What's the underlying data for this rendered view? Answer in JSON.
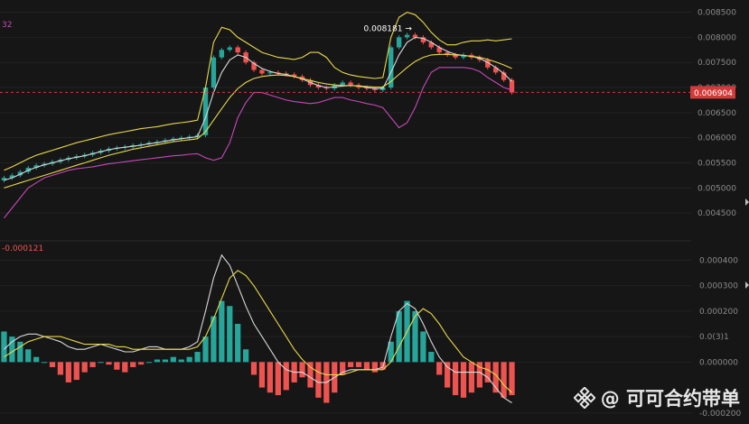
{
  "chart_data": [
    {
      "type": "line",
      "panel": "price",
      "indicator_label": "32",
      "y_ticks": [
        "0.008500",
        "0.008000",
        "0.007500",
        "0.007000",
        "0.006500",
        "0.006000",
        "0.005500",
        "0.005000",
        "0.004500"
      ],
      "ylim": [
        0.00425,
        0.0086
      ],
      "current_price_label": "0.006904",
      "current_price": 0.006904,
      "high_annotation": "0.008181",
      "high_value": 0.008181,
      "colors": {
        "up": "#26a69a",
        "down": "#ef5350",
        "ma_white": "#d8d8d8",
        "ma_yellow": "#e8d84a",
        "boll_magenta": "#c848b8",
        "price_tag": "#d33a3a"
      },
      "series": [
        {
          "role": "close",
          "values": [
            0.0052,
            0.00525,
            0.00532,
            0.0054,
            0.00545,
            0.00548,
            0.00552,
            0.00556,
            0.0056,
            0.00563,
            0.00566,
            0.0057,
            0.00574,
            0.00578,
            0.0058,
            0.00582,
            0.00585,
            0.00587,
            0.0059,
            0.00592,
            0.00595,
            0.00598,
            0.006,
            0.00602,
            0.00605,
            0.007,
            0.0076,
            0.00775,
            0.0078,
            0.0077,
            0.0075,
            0.00735,
            0.00728,
            0.0073,
            0.00728,
            0.00726,
            0.00722,
            0.00715,
            0.00705,
            0.007,
            0.00698,
            0.00705,
            0.0071,
            0.00705,
            0.007,
            0.00698,
            0.00695,
            0.007,
            0.0078,
            0.008,
            0.00805,
            0.008,
            0.0079,
            0.0078,
            0.0077,
            0.00765,
            0.0076,
            0.00765,
            0.0076,
            0.00755,
            0.0074,
            0.0073,
            0.00715,
            0.0069
          ]
        },
        {
          "role": "ma_short",
          "values": [
            0.00515,
            0.0052,
            0.00527,
            0.00535,
            0.00541,
            0.00546,
            0.0055,
            0.00554,
            0.00558,
            0.00561,
            0.00564,
            0.00568,
            0.00572,
            0.00576,
            0.00579,
            0.00581,
            0.00583,
            0.00585,
            0.00588,
            0.0059,
            0.00593,
            0.00596,
            0.00598,
            0.006,
            0.00602,
            0.0064,
            0.0069,
            0.0073,
            0.00755,
            0.00765,
            0.0076,
            0.00748,
            0.00738,
            0.00732,
            0.00728,
            0.00726,
            0.00722,
            0.00717,
            0.0071,
            0.00704,
            0.007,
            0.00701,
            0.00703,
            0.00704,
            0.00703,
            0.007,
            0.00698,
            0.00698,
            0.0073,
            0.00765,
            0.0079,
            0.008,
            0.00798,
            0.0079,
            0.0078,
            0.00772,
            0.00766,
            0.00764,
            0.00762,
            0.00758,
            0.0075,
            0.0074,
            0.00728,
            0.00712
          ]
        },
        {
          "role": "ma_long",
          "values": [
            0.005,
            0.00505,
            0.0051,
            0.00515,
            0.0052,
            0.00525,
            0.0053,
            0.00535,
            0.0054,
            0.00545,
            0.0055,
            0.00555,
            0.0056,
            0.00565,
            0.00569,
            0.00573,
            0.00577,
            0.0058,
            0.00583,
            0.00586,
            0.00589,
            0.00592,
            0.00594,
            0.00596,
            0.00598,
            0.00612,
            0.00635,
            0.00658,
            0.0068,
            0.00698,
            0.0071,
            0.00718,
            0.00722,
            0.00724,
            0.00725,
            0.00724,
            0.00722,
            0.00718,
            0.00714,
            0.0071,
            0.00707,
            0.00705,
            0.00704,
            0.00704,
            0.00703,
            0.00702,
            0.00701,
            0.00701,
            0.00712,
            0.00726,
            0.0074,
            0.00752,
            0.0076,
            0.00765,
            0.00766,
            0.00766,
            0.00765,
            0.00764,
            0.00762,
            0.0076,
            0.00756,
            0.00751,
            0.00745,
            0.00738
          ]
        },
        {
          "role": "boll_upper",
          "values": [
            0.00535,
            0.00542,
            0.0055,
            0.00558,
            0.00565,
            0.0057,
            0.00575,
            0.0058,
            0.00585,
            0.0059,
            0.00594,
            0.00598,
            0.00602,
            0.00606,
            0.00609,
            0.00612,
            0.00615,
            0.00618,
            0.0062,
            0.00622,
            0.00625,
            0.00628,
            0.0063,
            0.00632,
            0.00635,
            0.007,
            0.0079,
            0.0082,
            0.00815,
            0.008,
            0.0079,
            0.0078,
            0.0077,
            0.00765,
            0.0076,
            0.00758,
            0.00756,
            0.0076,
            0.0077,
            0.0077,
            0.0076,
            0.0074,
            0.0073,
            0.00725,
            0.00722,
            0.0072,
            0.00718,
            0.0072,
            0.008,
            0.0084,
            0.0085,
            0.00845,
            0.0083,
            0.0081,
            0.00795,
            0.00785,
            0.00785,
            0.0079,
            0.00793,
            0.00793,
            0.00795,
            0.00793,
            0.00795,
            0.00797
          ]
        },
        {
          "role": "boll_lower",
          "values": [
            0.0044,
            0.0046,
            0.0048,
            0.005,
            0.0051,
            0.0052,
            0.00525,
            0.0053,
            0.00535,
            0.00538,
            0.0054,
            0.00542,
            0.00545,
            0.00548,
            0.0055,
            0.00552,
            0.00554,
            0.00556,
            0.00558,
            0.0056,
            0.00562,
            0.00564,
            0.00565,
            0.00567,
            0.00568,
            0.0056,
            0.00555,
            0.0056,
            0.0059,
            0.0064,
            0.0067,
            0.0069,
            0.0069,
            0.00685,
            0.0068,
            0.00675,
            0.00672,
            0.0067,
            0.00668,
            0.0067,
            0.00675,
            0.0068,
            0.0068,
            0.00675,
            0.00672,
            0.00668,
            0.00665,
            0.0066,
            0.0064,
            0.0062,
            0.0063,
            0.0066,
            0.007,
            0.0073,
            0.0074,
            0.0074,
            0.0074,
            0.0074,
            0.00738,
            0.00732,
            0.0072,
            0.0071,
            0.007,
            0.00695
          ]
        }
      ]
    },
    {
      "type": "bar",
      "panel": "macd",
      "indicator_label": "-0.000121",
      "y_ticks": [
        "0.000400",
        "0.000300",
        "0.000200",
        "0.0(3)1",
        "0.000000",
        "-0.000200"
      ],
      "ylim": [
        -0.000215,
        0.00043
      ],
      "histogram": [
        0.00012,
        0.0001,
        8e-05,
        5e-05,
        2e-05,
        0.0,
        -2e-05,
        -5e-05,
        -8e-05,
        -7e-05,
        -4e-05,
        -2e-05,
        0.0,
        -1e-05,
        -3e-05,
        -4e-05,
        -2e-05,
        -1e-05,
        0.0,
        1e-05,
        1e-05,
        2e-05,
        1e-05,
        2e-05,
        4e-05,
        0.0001,
        0.00018,
        0.00024,
        0.00022,
        0.00015,
        5e-05,
        -5e-05,
        -0.0001,
        -0.00012,
        -0.00013,
        -0.00011,
        -8e-05,
        -6e-05,
        -0.0001,
        -0.00014,
        -0.00016,
        -0.00012,
        -5e-05,
        -2e-05,
        -2e-05,
        -3e-05,
        -4e-05,
        -3e-05,
        8e-05,
        0.0002,
        0.00024,
        0.0002,
        0.00012,
        4e-05,
        -5e-05,
        -0.0001,
        -0.00013,
        -0.00014,
        -0.00012,
        -0.0001,
        -8e-05,
        -0.00012,
        -0.00014,
        -0.00013
      ],
      "series": [
        {
          "role": "dif",
          "values": [
            5e-05,
            8e-05,
            0.0001,
            0.00011,
            0.00011,
            0.0001,
            9e-05,
            8e-05,
            6e-05,
            5e-05,
            5e-05,
            6e-05,
            7e-05,
            6e-05,
            5e-05,
            4e-05,
            4e-05,
            5e-05,
            6e-05,
            6e-05,
            5e-05,
            5e-05,
            5e-05,
            6e-05,
            8e-05,
            0.0002,
            0.00033,
            0.00042,
            0.00038,
            0.0003,
            0.00022,
            0.00015,
            0.0001,
            5e-05,
            0.0,
            -3e-05,
            -4e-05,
            -4e-05,
            -6e-05,
            -8e-05,
            -8e-05,
            -6e-05,
            -4e-05,
            -3e-05,
            -3e-05,
            -3e-05,
            -3e-05,
            -2e-05,
            0.0001,
            0.0002,
            0.00023,
            0.00021,
            0.00015,
            8e-05,
            2e-05,
            -2e-05,
            -4e-05,
            -4e-05,
            -4e-05,
            -4e-05,
            -6e-05,
            -0.0001,
            -0.00014,
            -0.00016
          ]
        },
        {
          "role": "dea",
          "values": [
            2e-05,
            4e-05,
            6e-05,
            8e-05,
            9e-05,
            0.0001,
            0.0001,
            0.0001,
            9e-05,
            8e-05,
            7e-05,
            7e-05,
            7e-05,
            7e-05,
            6e-05,
            6e-05,
            5e-05,
            5e-05,
            5e-05,
            5e-05,
            5e-05,
            5e-05,
            5e-05,
            5e-05,
            6e-05,
            0.0001,
            0.00017,
            0.00025,
            0.00033,
            0.00036,
            0.00034,
            0.0003,
            0.00025,
            0.0002,
            0.00015,
            0.0001,
            5e-05,
            1e-05,
            -2e-05,
            -4e-05,
            -5e-05,
            -5e-05,
            -5e-05,
            -4e-05,
            -3e-05,
            -3e-05,
            -3e-05,
            -3e-05,
            0.0,
            6e-05,
            0.00012,
            0.00018,
            0.00021,
            0.00019,
            0.00015,
            0.0001,
            6e-05,
            2e-05,
            0.0,
            -2e-05,
            -3e-05,
            -5e-05,
            -9e-05,
            -0.00012
          ]
        }
      ]
    }
  ],
  "watermark": {
    "text": "@ 可可合约带单"
  }
}
